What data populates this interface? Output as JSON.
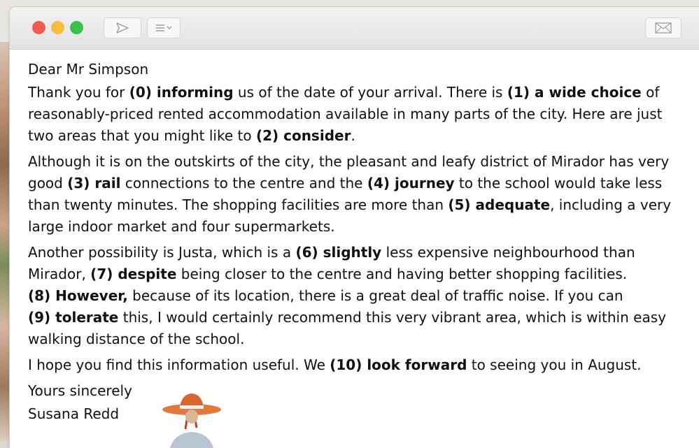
{
  "toolbar": {
    "send_icon": "paper-plane-icon",
    "list_icon": "list-dropdown-icon",
    "mail_icon": "envelope-icon"
  },
  "colors": {
    "close": "#ee5b52",
    "minimize": "#f5bd3b",
    "maximize": "#37c24b"
  },
  "letter": {
    "greeting": "Dear Mr Simpson",
    "p1": {
      "t1": "Thank you for ",
      "b0": "(0) informing",
      "t2": " us of the date of your arrival. There is ",
      "b1": "(1) a wide choice",
      "t3": " of reasonably-priced rented accommodation available in many parts of the city. Here are just two areas that you might like to ",
      "b2": "(2) consider",
      "t4": "."
    },
    "p2": {
      "t1": "Although it is on the outskirts of the city, the pleasant and leafy district of Mirador has very good ",
      "b3": "(3) rail",
      "t2": " connections to the centre and the ",
      "b4": "(4) journey",
      "t3": " to the school would take less than twenty minutes. The shopping facilities are more than ",
      "b5": "(5) adequate",
      "t4": ", including a very large indoor market and four supermarkets."
    },
    "p3": {
      "t1": "Another possibility is Justa, which is a ",
      "b6": "(6) slightly",
      "t2": " less expensive neighbourhood than Mirador, ",
      "b7": "(7) despite",
      "t3": " being closer to the centre and having better shopping facilities.",
      "b8": "(8) However,",
      "t4": " because of its location, there is a great deal of traffic noise. If you can",
      "b9": "(9) tolerate",
      "t5": " this, I would certainly recommend this very vibrant area, which is within easy walking distance of the school."
    },
    "p4": {
      "t1": "I hope you find this information useful. We ",
      "b10": "(10) look forward",
      "t2": " to seeing you in August."
    },
    "closing": "Yours sincerely",
    "signature": "Susana Redd"
  }
}
